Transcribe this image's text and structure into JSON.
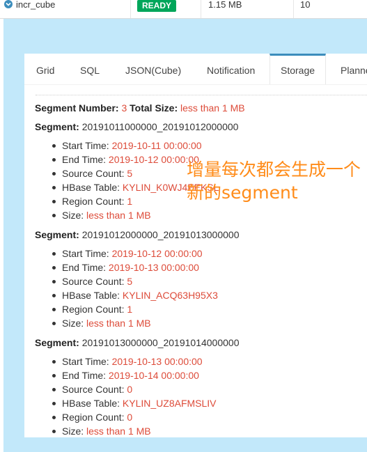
{
  "cube_row": {
    "name": "incr_cube",
    "status": "READY",
    "size": "1.15 MB",
    "count": "10",
    "expand_icon": "chevron-down-circle-icon"
  },
  "tabs": [
    "Grid",
    "SQL",
    "JSON(Cube)",
    "Notification",
    "Storage",
    "Planner"
  ],
  "active_tab": "Storage",
  "summary": {
    "segment_number_label": "Segment Number:",
    "segment_number": "3",
    "total_size_label": "Total Size:",
    "total_size": "less than 1 MB"
  },
  "labels": {
    "segment": "Segment:",
    "start_time": "Start Time:",
    "end_time": "End Time:",
    "source_count": "Source Count:",
    "hbase_table": "HBase Table:",
    "region_count": "Region Count:",
    "size": "Size:"
  },
  "segments": [
    {
      "name": "20191011000000_20191012000000",
      "start_time": "2019-10-11 00:00:00",
      "end_time": "2019-10-12 00:00:00",
      "source_count": "5",
      "hbase_table": "KYLIN_K0WJ4EEKSL",
      "region_count": "1",
      "size": "less than 1 MB"
    },
    {
      "name": "20191012000000_20191013000000",
      "start_time": "2019-10-12 00:00:00",
      "end_time": "2019-10-13 00:00:00",
      "source_count": "5",
      "hbase_table": "KYLIN_ACQ63H95X3",
      "region_count": "1",
      "size": "less than 1 MB"
    },
    {
      "name": "20191013000000_20191014000000",
      "start_time": "2019-10-13 00:00:00",
      "end_time": "2019-10-14 00:00:00",
      "source_count": "0",
      "hbase_table": "KYLIN_UZ8AFMSLIV",
      "region_count": "0",
      "size": "less than 1 MB"
    }
  ],
  "annotation": {
    "line1": "增量每次都会生成一个",
    "line2": "新的segment"
  },
  "colors": {
    "ready_green": "#00a65a",
    "value_red": "#dd4b39",
    "background_blue": "#c2e8fa",
    "tab_accent": "#3c8dbc",
    "annotation_orange": "#ff8c1a"
  }
}
